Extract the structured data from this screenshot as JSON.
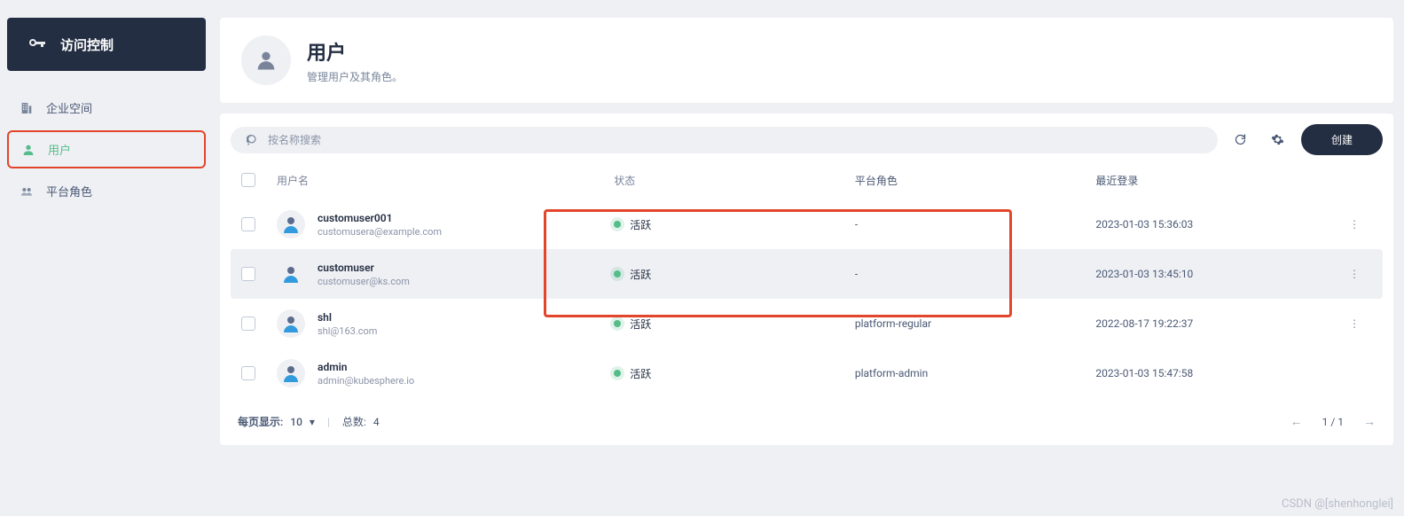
{
  "sidebar": {
    "title": "访问控制",
    "items": [
      {
        "label": "企业空间",
        "active": false
      },
      {
        "label": "用户",
        "active": true
      },
      {
        "label": "平台角色",
        "active": false
      }
    ]
  },
  "header": {
    "title": "用户",
    "subtitle": "管理用户及其角色。"
  },
  "toolbar": {
    "search_placeholder": "按名称搜索",
    "create_label": "创建"
  },
  "table": {
    "columns": {
      "name": "用户名",
      "status": "状态",
      "role": "平台角色",
      "login": "最近登录"
    },
    "rows": [
      {
        "name": "customuser001",
        "email": "customusera@example.com",
        "status": "活跃",
        "role": "-",
        "login": "2023-01-03 15:36:03",
        "hover": false,
        "more": true
      },
      {
        "name": "customuser",
        "email": "customuser@ks.com",
        "status": "活跃",
        "role": "-",
        "login": "2023-01-03 13:45:10",
        "hover": true,
        "more": true
      },
      {
        "name": "shl",
        "email": "shl@163.com",
        "status": "活跃",
        "role": "platform-regular",
        "login": "2022-08-17 19:22:37",
        "hover": false,
        "more": true
      },
      {
        "name": "admin",
        "email": "admin@kubesphere.io",
        "status": "活跃",
        "role": "platform-admin",
        "login": "2023-01-03 15:47:58",
        "hover": false,
        "more": false
      }
    ]
  },
  "pagination": {
    "per_page_label": "每页显示:",
    "per_page_value": "10",
    "total_label": "总数:",
    "total_value": "4",
    "page_text": "1 / 1"
  },
  "watermark": "CSDN @[shenhonglei]"
}
